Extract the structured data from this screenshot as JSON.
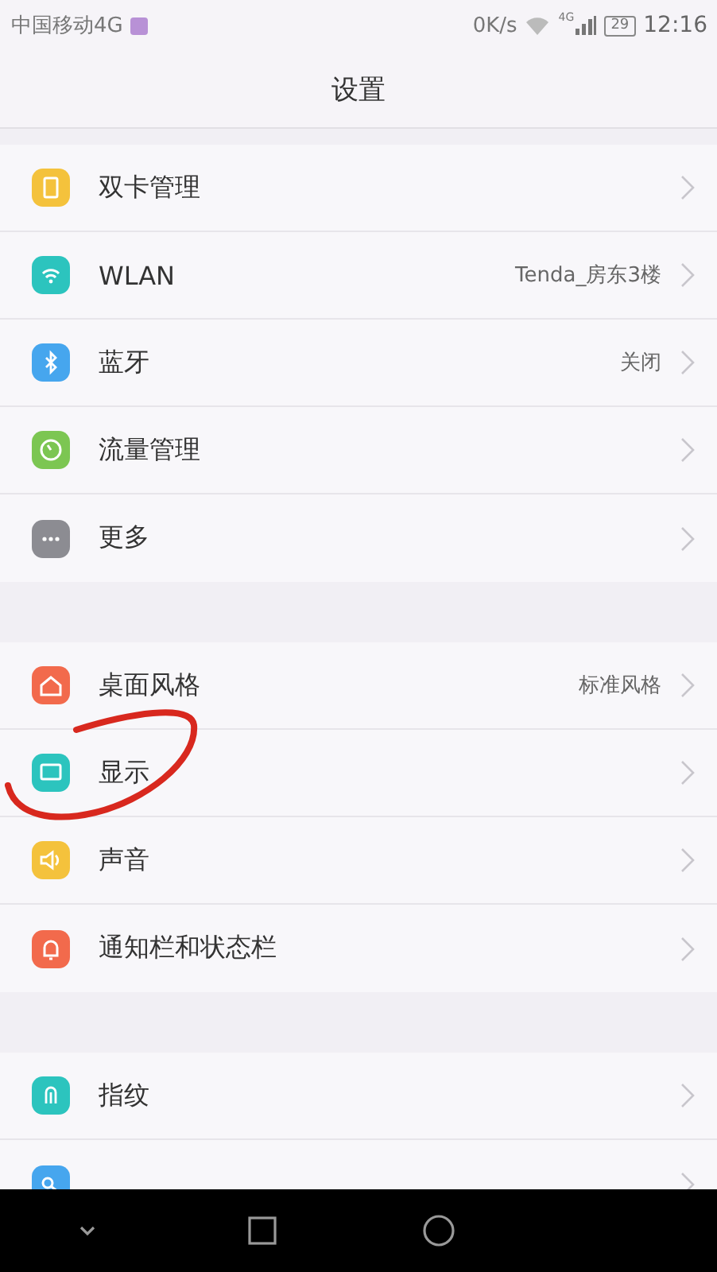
{
  "status_bar": {
    "carrier": "中国移动4G",
    "speed": "0K/s",
    "network": "4G",
    "battery": "29",
    "time": "12:16"
  },
  "title": "设置",
  "groups": [
    {
      "items": [
        {
          "label": "双卡管理",
          "color": "#f4c23c"
        },
        {
          "label": "WLAN",
          "value": "Tenda_房东3楼",
          "color": "#2cc4be"
        },
        {
          "label": "蓝牙",
          "value": "关闭",
          "color": "#46a6ee"
        },
        {
          "label": "流量管理",
          "color": "#7cc652"
        },
        {
          "label": "更多",
          "color": "#8c8c92"
        }
      ]
    },
    {
      "items": [
        {
          "label": "桌面风格",
          "value": "标准风格",
          "color": "#f26a4c"
        },
        {
          "label": "显示",
          "color": "#2cc4be"
        },
        {
          "label": "声音",
          "color": "#f4c23c"
        },
        {
          "label": "通知栏和状态栏",
          "color": "#f26a4c"
        }
      ]
    },
    {
      "items": [
        {
          "label": "指纹",
          "color": "#2cc4be"
        },
        {
          "color": "#46a6ee"
        }
      ]
    }
  ]
}
